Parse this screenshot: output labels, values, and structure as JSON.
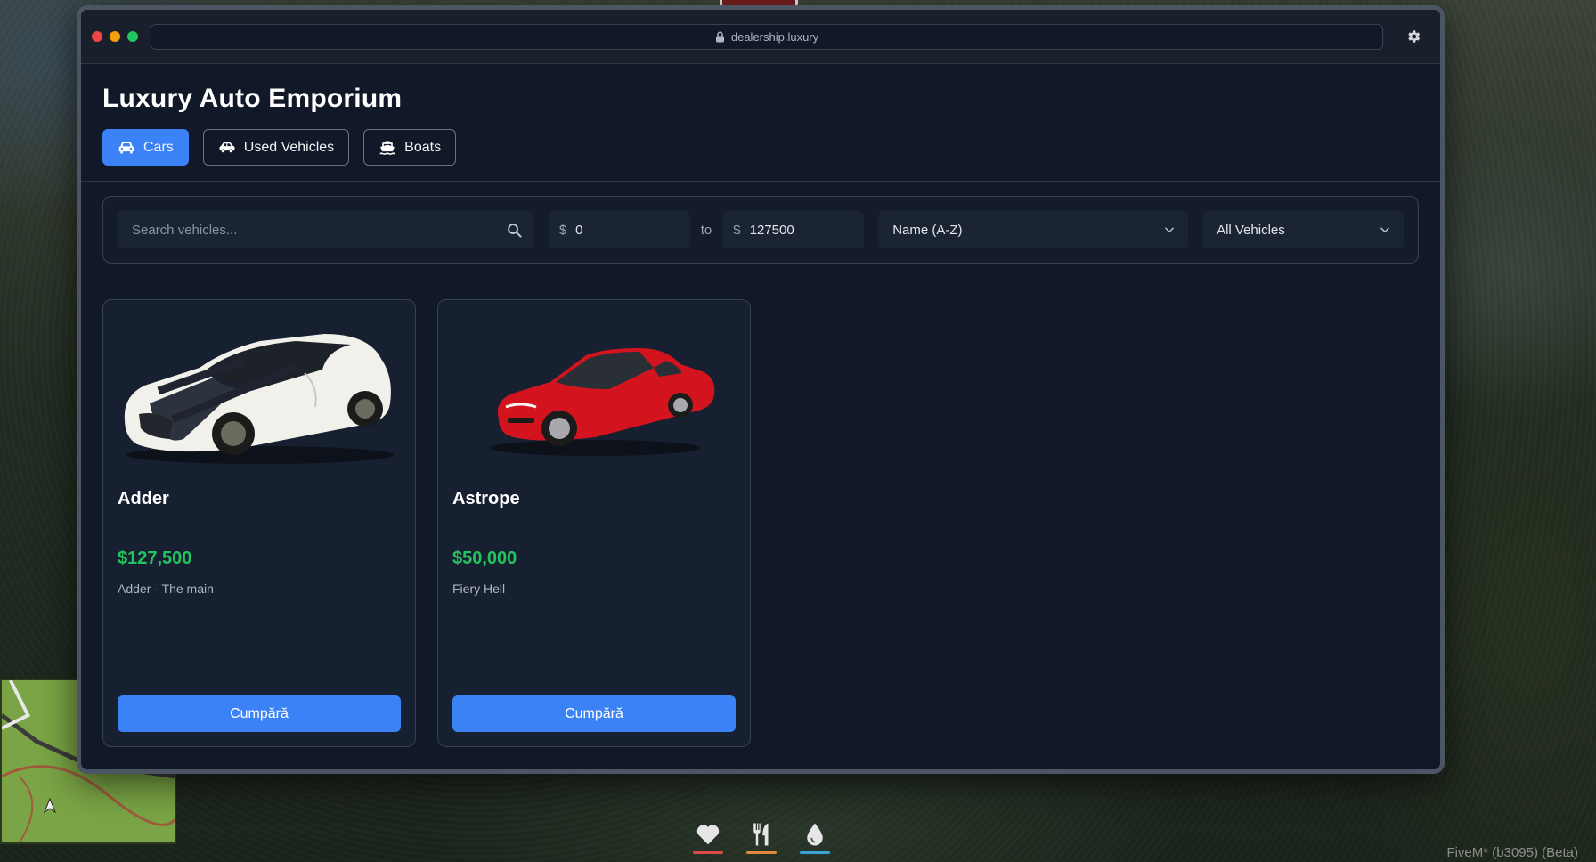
{
  "window": {
    "url": "dealership.luxury",
    "traffic_lights": [
      "#ef4444",
      "#f59e0b",
      "#22c55e"
    ]
  },
  "header": {
    "title": "Luxury Auto Emporium",
    "tabs": [
      {
        "label": "Cars",
        "icon": "car-icon",
        "active": true
      },
      {
        "label": "Used Vehicles",
        "icon": "used-car-icon",
        "active": false
      },
      {
        "label": "Boats",
        "icon": "boat-icon",
        "active": false
      }
    ]
  },
  "filters": {
    "search_placeholder": "Search vehicles...",
    "currency_symbol": "$",
    "price_min": "0",
    "to_label": "to",
    "price_max": "127500",
    "sort_selected": "Name (A-Z)",
    "category_selected": "All Vehicles"
  },
  "vehicles": [
    {
      "name": "Adder",
      "price": "$127,500",
      "description": "Adder - The main",
      "buy_label": "Cumpără",
      "body_color": "#f1f0ea"
    },
    {
      "name": "Astrope",
      "price": "$50,000",
      "description": "Fiery Hell",
      "buy_label": "Cumpără",
      "body_color": "#d3141f"
    }
  ],
  "colors": {
    "accent": "#3b82f6",
    "price_green": "#22c55e",
    "background": "#111827"
  },
  "hud": {
    "items": [
      {
        "icon": "heart-icon",
        "color": "#dc4a4a",
        "level": 1.0
      },
      {
        "icon": "fork-knife-icon",
        "color": "#e0893a",
        "level": 1.0
      },
      {
        "icon": "water-drop-icon",
        "color": "#3aa3d8",
        "level": 1.0
      }
    ],
    "version": "FiveM* (b3095) (Beta)"
  }
}
